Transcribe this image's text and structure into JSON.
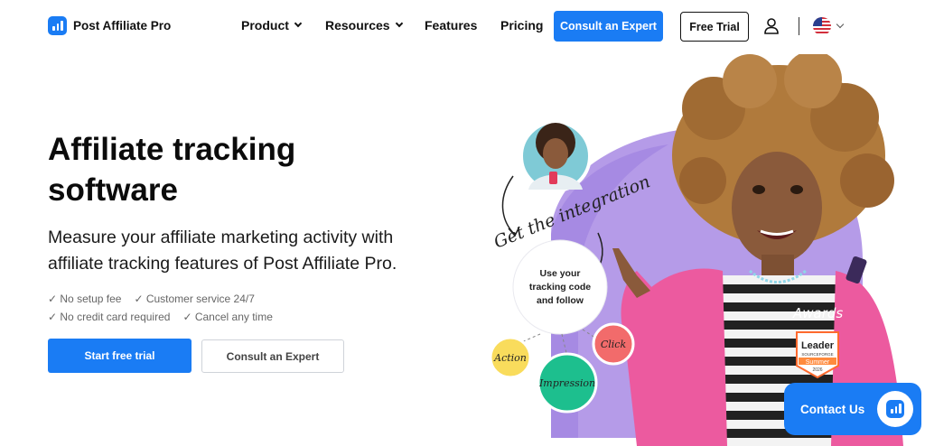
{
  "brand": {
    "name": "Post Affiliate Pro"
  },
  "nav": {
    "product": "Product",
    "resources": "Resources",
    "features": "Features",
    "pricing": "Pricing",
    "consult_button": "Consult an Expert",
    "trial_button": "Free Trial"
  },
  "hero": {
    "title_line1": "Affiliate tracking",
    "title_line2": "software",
    "subtitle_line1": "Measure your affiliate marketing activity with",
    "subtitle_line2": "affiliate tracking features of Post Affiliate Pro.",
    "checks": [
      "✓ No setup fee",
      "✓ Customer service 24/7",
      "✓ No credit card required",
      "✓ Cancel any time"
    ],
    "primary_button": "Start free trial",
    "secondary_button": "Consult an Expert"
  },
  "illustration": {
    "handwritten": "Get the integration",
    "bubble_line1": "Use your",
    "bubble_line2": "tracking code",
    "bubble_line3": "and follow",
    "action": "Action",
    "click": "Click",
    "impression": "Impression",
    "awards": "Awards",
    "badge_title": "Leader",
    "badge_source": "SOURCEFORGE",
    "badge_season": "Summer",
    "badge_year": "2026"
  },
  "contact": {
    "label": "Contact Us"
  },
  "colors": {
    "brand_blue": "#1a7cf4",
    "purple": "#b59be8",
    "yellow": "#f9dc5c",
    "coral": "#f26b6b",
    "teal": "#1dbf8e",
    "pink_jacket": "#ec5a9f"
  }
}
